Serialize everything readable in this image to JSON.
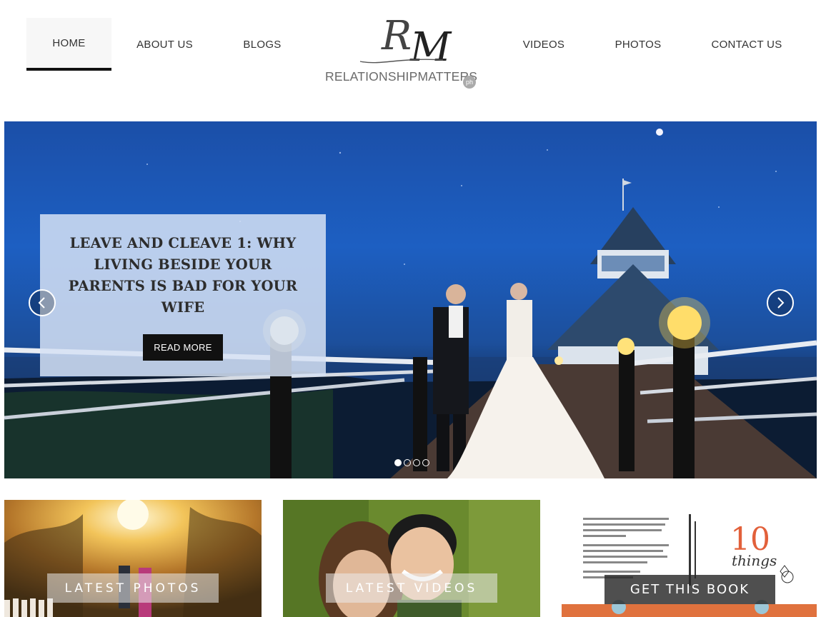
{
  "nav": {
    "left_items": [
      {
        "label": "HOME",
        "active": true
      },
      {
        "label": "ABOUT US",
        "active": false
      },
      {
        "label": "BLOGS",
        "active": false
      }
    ],
    "right_items": [
      {
        "label": "VIDEOS",
        "active": false
      },
      {
        "label": "PHOTOS",
        "active": false
      },
      {
        "label": "CONTACT US",
        "active": false
      }
    ]
  },
  "logo": {
    "monogram_r": "R",
    "monogram_m": "M",
    "text": "RELATIONSHIPMATTERS",
    "badge": "ph"
  },
  "hero": {
    "slide_title": "LEAVE AND CLEAVE 1: WHY LIVING BESIDE YOUR PARENTS IS BAD FOR YOUR WIFE",
    "button_label": "READ MORE",
    "prev_icon": "chevron-left-icon",
    "next_icon": "chevron-right-icon",
    "slide_count": 4,
    "active_slide": 1
  },
  "tiles": [
    {
      "label": "LATEST PHOTOS"
    },
    {
      "label": "LATEST VIDEOS"
    },
    {
      "label": "GET THIS BOOK"
    }
  ],
  "colors": {
    "accent_dark": "#111111",
    "hero_sky": "#1d5fc2",
    "caption_bg": "#d6e2f4"
  }
}
